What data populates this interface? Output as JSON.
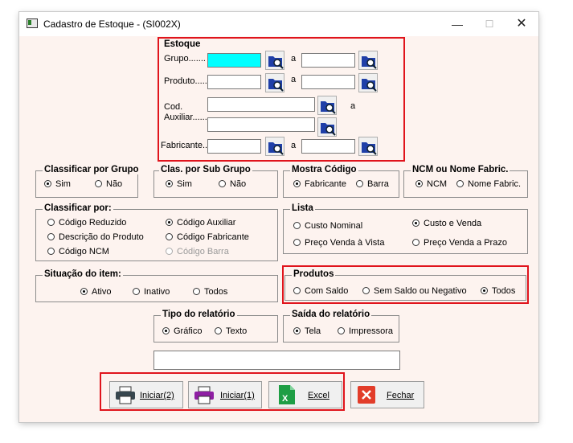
{
  "window": {
    "title": "Cadastro de Estoque - (SI002X)",
    "minimize": "—",
    "maximize": "☐",
    "close": "✕"
  },
  "estoque": {
    "legend": "Estoque",
    "grupo_label": "Grupo.......",
    "produto_label": "Produto.......",
    "cod_label": "Cod.",
    "auxiliar_label": "Auxiliar.......",
    "fabricante_label": "Fabricante......",
    "a": "a"
  },
  "classificar_grupo": {
    "legend": "Classificar por Grupo",
    "sim": "Sim",
    "nao": "Não",
    "selected": "Sim"
  },
  "clas_sub_grupo": {
    "legend": "Clas. por Sub Grupo",
    "sim": "Sim",
    "nao": "Não",
    "selected": "Sim"
  },
  "mostra_codigo": {
    "legend": "Mostra Código",
    "fabricante": "Fabricante",
    "barra": "Barra",
    "selected": "Fabricante"
  },
  "ncm_nome": {
    "legend": "NCM ou Nome Fabric.",
    "ncm": "NCM",
    "nome": "Nome Fabric.",
    "selected": "NCM"
  },
  "classificar_por": {
    "legend": "Classificar por:",
    "codigo_reduzido": "Código Reduzido",
    "descricao_produto": "Descrição do Produto",
    "codigo_ncm": "Código NCM",
    "codigo_auxiliar": "Código Auxiliar",
    "codigo_fabricante": "Código Fabricante",
    "codigo_barra": "Código Barra",
    "selected": "Código Auxiliar"
  },
  "lista": {
    "legend": "Lista",
    "custo_nominal": "Custo Nominal",
    "preco_vista": "Preço Venda à Vista",
    "custo_venda": "Custo e Venda",
    "preco_prazo": "Preço Venda a Prazo",
    "selected": "Custo e Venda"
  },
  "situacao": {
    "legend": "Situação do item:",
    "ativo": "Ativo",
    "inativo": "Inativo",
    "todos": "Todos",
    "selected": "Ativo"
  },
  "produtos": {
    "legend": "Produtos",
    "com_saldo": "Com Saldo",
    "sem_saldo": "Sem Saldo ou Negativo",
    "todos": "Todos",
    "selected": "Todos"
  },
  "tipo_relatorio": {
    "legend": "Tipo do relatório",
    "grafico": "Gráfico",
    "texto": "Texto",
    "selected": "Gráfico"
  },
  "saida_relatorio": {
    "legend": "Saída do relatório",
    "tela": "Tela",
    "impressora": "Impressora",
    "selected": "Tela"
  },
  "buttons": {
    "iniciar2": "Iniciar(2)",
    "iniciar1": "Iniciar(1)",
    "excel": "Excel",
    "fechar": "Fechar"
  },
  "colors": {
    "accent_red": "#e0141c",
    "focus_cyan": "#00ffff",
    "window_bg": "#fdf3ef"
  }
}
